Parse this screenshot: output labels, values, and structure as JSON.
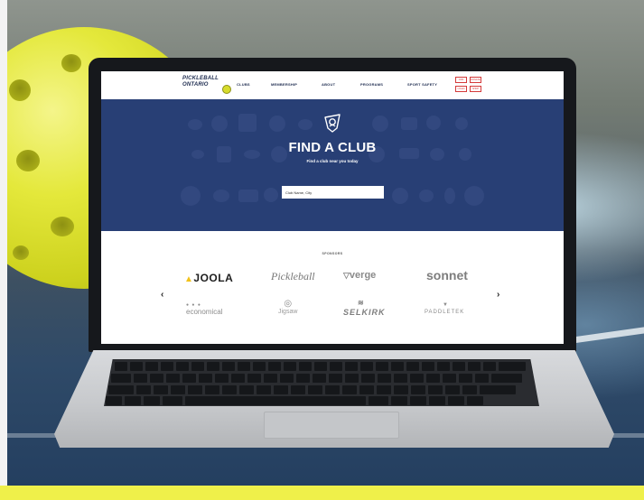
{
  "site": {
    "logo_line1": "PICKLEBALL",
    "logo_line2": "ONTARIO",
    "nav": {
      "clubs": "CLUBS",
      "membership": "MEMBERSHIP",
      "about": "ABOUT",
      "programs": "PROGRAMS",
      "sport_safety": "SPORT SAFETY"
    },
    "nav_buttons": [
      "JOIN",
      "DONATE",
      "LOGIN",
      "SHOP"
    ]
  },
  "hero": {
    "title": "FIND A CLUB",
    "subtitle": "Find a club near you today",
    "search_placeholder": "Club Name, City"
  },
  "sponsors": {
    "label": "SPONSORS",
    "prev_arrow": "‹",
    "next_arrow": "›",
    "items": [
      {
        "name": "JOOLA",
        "color": "#1e1e1e",
        "accent": "#f2c21b"
      },
      {
        "name": "Pickleball",
        "color": "#777777"
      },
      {
        "name": "verge",
        "color": "#8a8a8a"
      },
      {
        "name": "sonnet",
        "color": "#7d7d7d"
      },
      {
        "name": "economical",
        "color": "#8c8c8c"
      },
      {
        "name": "Jigsaw",
        "color": "#9a9a9a"
      },
      {
        "name": "SELKIRK",
        "color": "#7d7d7d"
      },
      {
        "name": "PADDLETEK",
        "color": "#8a8a8a"
      }
    ]
  },
  "colors": {
    "hero_blue": "#283f75",
    "brand_yellow": "#eff04a",
    "button_red": "#d43a3a"
  }
}
